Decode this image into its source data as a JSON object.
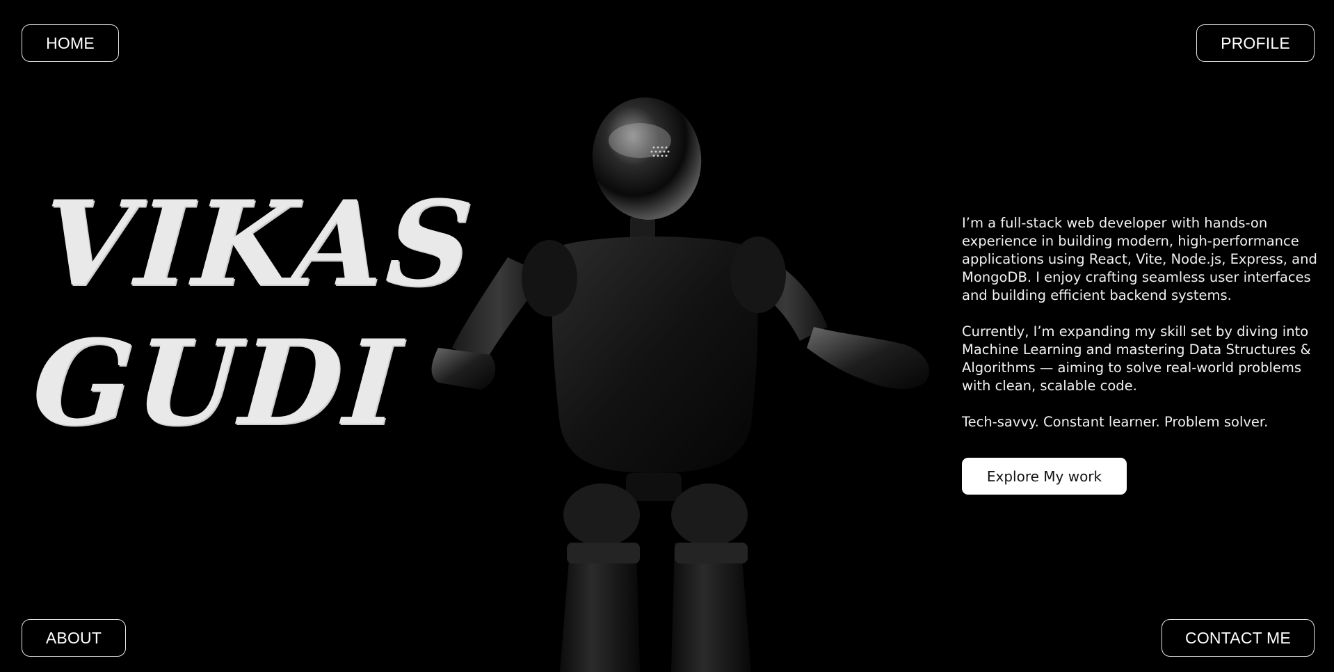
{
  "nav": {
    "home": "HOME",
    "profile": "PROFILE",
    "about": "ABOUT",
    "contact": "CONTACT ME"
  },
  "hero": {
    "name_line1": "VIKAS",
    "name_line2": "GUDI"
  },
  "bio": {
    "paragraph1": "I’m a full-stack web developer with hands-on experience in building modern, high-performance applications using React, Vite, Node.js, Express, and MongoDB. I enjoy crafting seamless user interfaces and building efficient backend systems.",
    "paragraph2": "Currently, I’m expanding my skill set by diving into Machine Learning and mastering Data Structures & Algorithms — aiming to solve real-world problems with clean, scalable code.",
    "tagline": "Tech-savvy. Constant learner. Problem solver."
  },
  "cta": {
    "label": "Explore My work"
  },
  "colors": {
    "background": "#000000",
    "text": "#ffffff",
    "name": "#e9e9e9",
    "button_bg": "#ffffff",
    "button_text": "#111111"
  }
}
